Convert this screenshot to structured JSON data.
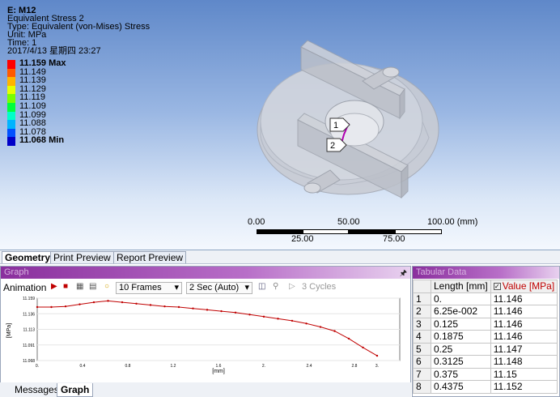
{
  "result": {
    "title": "E: M12",
    "name": "Equivalent Stress 2",
    "type": "Type: Equivalent (von-Mises) Stress",
    "unit": "Unit: MPa",
    "time": "Time: 1",
    "date": "2017/4/13 星期四 23:27"
  },
  "legend": [
    {
      "label": "11.159 Max",
      "color": "#ff0000",
      "bold": true
    },
    {
      "label": "11.149",
      "color": "#ff5a00",
      "bold": false
    },
    {
      "label": "11.139",
      "color": "#ffb400",
      "bold": false
    },
    {
      "label": "11.129",
      "color": "#e6ff00",
      "bold": false
    },
    {
      "label": "11.119",
      "color": "#78ff00",
      "bold": false
    },
    {
      "label": "11.109",
      "color": "#00ff3c",
      "bold": false
    },
    {
      "label": "11.099",
      "color": "#00ffc8",
      "bold": false
    },
    {
      "label": "11.088",
      "color": "#00b4ff",
      "bold": false
    },
    {
      "label": "11.078",
      "color": "#0050ff",
      "bold": false
    },
    {
      "label": "11.068 Min",
      "color": "#0000c8",
      "bold": true
    }
  ],
  "probes": [
    "1",
    "2"
  ],
  "scale": {
    "top": [
      "0.00",
      "50.00",
      "100.00 (mm)"
    ],
    "bottom": [
      "25.00",
      "75.00"
    ]
  },
  "view_tabs": [
    "Geometry",
    "Print Preview",
    "Report Preview"
  ],
  "graph": {
    "header": "Graph",
    "animation_label": "Animation",
    "frames": "10 Frames",
    "duration": "2 Sec (Auto)",
    "cycles": "3 Cycles",
    "y_axis_label": "[MPa]",
    "x_axis_label": "[mm]"
  },
  "bottom_tabs": [
    "Messages",
    "Graph"
  ],
  "table": {
    "header": "Tabular Data",
    "columns": [
      "Length [mm]",
      "Value [MPa]"
    ],
    "rows": [
      [
        "1",
        "0.",
        "11.146"
      ],
      [
        "2",
        "6.25e-002",
        "11.146"
      ],
      [
        "3",
        "0.125",
        "11.146"
      ],
      [
        "4",
        "0.1875",
        "11.146"
      ],
      [
        "5",
        "0.25",
        "11.147"
      ],
      [
        "6",
        "0.3125",
        "11.148"
      ],
      [
        "7",
        "0.375",
        "11.15"
      ],
      [
        "8",
        "0.4375",
        "11.152"
      ]
    ]
  },
  "chart_data": {
    "type": "line",
    "title": "",
    "xlabel": "[mm]",
    "ylabel": "[MPa]",
    "xlim": [
      0,
      3.2
    ],
    "ylim": [
      11.068,
      11.159
    ],
    "x_ticks": [
      "0.",
      "0.4",
      "0.8",
      "1.2",
      "1.6",
      "2.",
      "2.4",
      "2.8",
      "3."
    ],
    "y_ticks": [
      "11.159",
      "11.136",
      "11.113",
      "11.091",
      "11.068"
    ],
    "x": [
      0,
      0.125,
      0.25,
      0.375,
      0.5,
      0.625,
      0.75,
      0.875,
      1.0,
      1.125,
      1.25,
      1.375,
      1.5,
      1.625,
      1.75,
      1.875,
      2.0,
      2.125,
      2.25,
      2.375,
      2.5,
      2.625,
      2.75,
      2.875,
      3.0
    ],
    "series": [
      {
        "values": [
          11.146,
          11.146,
          11.147,
          11.15,
          11.153,
          11.155,
          11.153,
          11.151,
          11.149,
          11.147,
          11.146,
          11.144,
          11.142,
          11.14,
          11.138,
          11.135,
          11.132,
          11.129,
          11.126,
          11.122,
          11.117,
          11.111,
          11.1,
          11.087,
          11.075
        ]
      }
    ]
  }
}
